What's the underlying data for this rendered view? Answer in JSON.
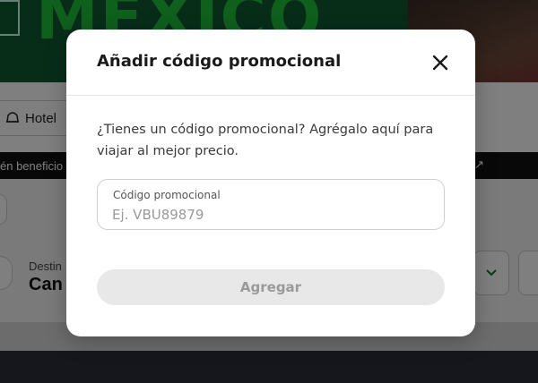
{
  "background": {
    "hero_text": "MEXICO",
    "tab_hotel_label": "Hotel",
    "stripe_text": "én beneficio",
    "field_label": "Destin",
    "field_value": "Can"
  },
  "modal": {
    "title": "Añadir código promocional",
    "description": "¿Tienes un código promocional? Agrégalo aquí para viajar al mejor precio.",
    "promo_field": {
      "label": "Código promocional",
      "placeholder": "Ej. VBU89879",
      "value": ""
    },
    "add_button_label": "Agregar",
    "add_button_disabled": true
  },
  "colors": {
    "overlay": "rgba(0,0,0,0.5)",
    "hero_green": "#0f5a33",
    "accent_green": "#0a7a3a",
    "disabled_button_bg": "#e8e8e8",
    "disabled_button_text": "#9a9a9a"
  },
  "icons": {
    "close": "close-icon",
    "hotel": "hotel-icon",
    "chevron": "chevron-down-icon",
    "external": "arrow-up-right-icon"
  }
}
